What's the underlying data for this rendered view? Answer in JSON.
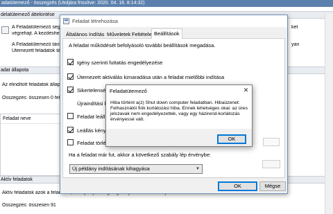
{
  "background": {
    "title_text": "adatütemező - összegzés (Utoljára frissítve: 2020. 04. 16. 8:14:32)",
    "overview_header": "delatütemező áttekintése",
    "overview_line1": "A Feladatütemező segí",
    "overview_line1_right": "ket",
    "overview_line2": "végrehajt. A kezdéshez",
    "overview_line3": "A Feladatütemező tárolása az",
    "overview_line3_right": "yan",
    "overview_line4": "Ütemezett feladatok tár",
    "status_header": "adat állapota",
    "status_filter": "Az elindított feladatok állapo",
    "status_summary": "Összegzés: összesen 0 feladat",
    "list_header": "Feladat neve",
    "active_header": "Aktív feladatok",
    "active_desc": "Aktív feladatok azok a feladatok, amelyek jelenleg engedélyezettek és nem jártak le.",
    "active_summary": "Összegzés: összesen 91"
  },
  "dialog": {
    "title": "Feladat létrehozása",
    "tabs": [
      "Általános",
      "Indítás",
      "Műveletek",
      "Feltételek",
      "Beállítások"
    ],
    "active_tab": "Beállítások",
    "description": "A feladat működését befolyásoló további beállítások megadása.",
    "options": [
      {
        "label": "Igény szerinti futtatás engedélyezése",
        "checked": true
      },
      {
        "label": "Ütemezett aktiválás kimaradása után a feladat mielőbbi indítása",
        "checked": true
      },
      {
        "label": "Sikertelenség es",
        "checked": true
      },
      {
        "label": "Újraindítási kís",
        "checked": null
      },
      {
        "label": "Feladat leállítás",
        "checked": false
      },
      {
        "label": "Leállás kényszeri",
        "checked": true
      },
      {
        "label": "Feladat törlése, h",
        "checked": false
      }
    ],
    "running_rule_label": "Ha a feladat már fut, akkor a következő szabály lép érvénybe:",
    "running_rule_value": "Új példány indításának kihagyása",
    "ok_label": "OK",
    "cancel_label": "Mégse"
  },
  "message_box": {
    "title": "Feladatütemező",
    "lines": [
      "Hiba történt a(z) Shut down computer feladatban. Hibaüzenet:",
      "Felhasználói fiók korlátozási hiba.  Ennek lehetséges okai: az üres",
      "jelszavak nem engedélyezettek, vagy egy házirend-korlátozás",
      "érvényessé vált."
    ],
    "ok_label": "OK",
    "close_symbol": "✕"
  }
}
